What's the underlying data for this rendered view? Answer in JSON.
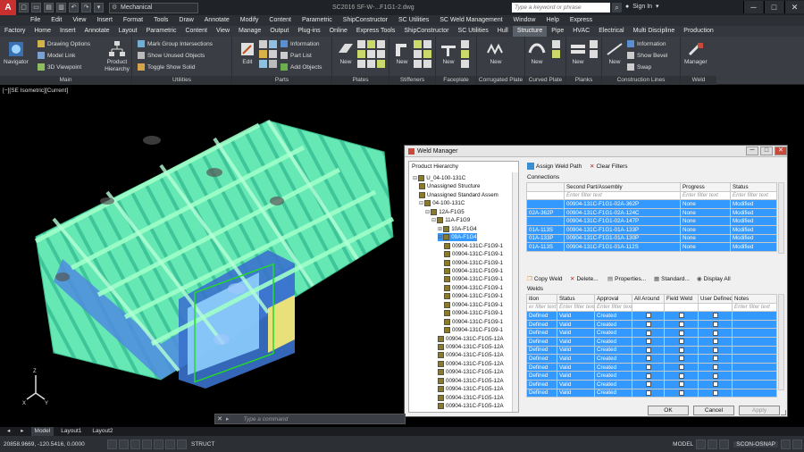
{
  "titlebar": {
    "app_letter": "A",
    "workspace": "Mechanical",
    "doc_title": "SC2016    SF-W-...F1G1-2.dwg",
    "search_placeholder": "Type a keyword or phrase",
    "signin": "Sign In",
    "qat": [
      "▢",
      "▭",
      "▤",
      "▥",
      "↶",
      "↷",
      "▾"
    ]
  },
  "menus": [
    "File",
    "Edit",
    "View",
    "Insert",
    "Format",
    "Tools",
    "Draw",
    "Annotate",
    "Modify",
    "Content",
    "Parametric",
    "ShipConstructor",
    "SC Utilities",
    "SC Weld Management",
    "Window",
    "Help",
    "Express"
  ],
  "ribbon_tabs": [
    "Factory",
    "Home",
    "Insert",
    "Annotate",
    "Layout",
    "Parametric",
    "Content",
    "View",
    "Manage",
    "Output",
    "Plug-ins",
    "Online",
    "Express Tools",
    "ShipConstructor",
    "SC Utilities",
    "Hull",
    "Structure",
    "Pipe",
    "HVAC",
    "Electrical",
    "Multi Discipline",
    "Production"
  ],
  "active_tab": "Structure",
  "ribbon": {
    "main": {
      "title": "Main",
      "navigator": "Navigator",
      "drawing_options": "Drawing Options",
      "model_link": "Model Link",
      "viewpoint": "3D Viewpoint",
      "product_hierarchy": "Product Hierarchy"
    },
    "utilities": {
      "title": "Utilities",
      "mark_group": "Mark Group Intersections",
      "show_unused": "Show Unused Objects",
      "toggle_solid": "Toggle Show Solid"
    },
    "parts": {
      "title": "Parts",
      "edit": "Edit",
      "information": "Information",
      "part_list": "Part List",
      "add_objects": "Add Objects"
    },
    "plates": {
      "title": "Plates",
      "new": "New"
    },
    "stiffeners": {
      "title": "Stiffeners",
      "new": "New"
    },
    "faceplate": {
      "title": "Faceplate",
      "new": "New"
    },
    "corrugated": {
      "title": "Corrugated Plate",
      "new": "New"
    },
    "curved": {
      "title": "Curved Plate",
      "new": "New"
    },
    "planks": {
      "title": "Planks",
      "new": "New"
    },
    "construction": {
      "title": "Construction Lines",
      "new": "New",
      "information": "Information",
      "show_bevel": "Show Bevel",
      "swap": "Swap"
    },
    "weld": {
      "title": "Weld",
      "manager": "Manager"
    }
  },
  "viewport": {
    "label": "[−][SE Isometric][Current]"
  },
  "command": {
    "placeholder": "Type a command",
    "close": "✕"
  },
  "layouts": [
    "Model",
    "Layout1",
    "Layout2"
  ],
  "active_layout": "Model",
  "status": {
    "coords": "20858.9669, -120.5416, 0.0000",
    "ortho": "STRUCT",
    "model": "MODEL",
    "scon": "SCON-OSNAP"
  },
  "weld_manager": {
    "title": "Weld Manager",
    "ph_title": "Product Hierarchy",
    "tree": [
      {
        "label": "U_04-100-131C",
        "depth": 0,
        "exp": "⊟"
      },
      {
        "label": "Unassigned Structure",
        "depth": 1,
        "exp": ""
      },
      {
        "label": "Unassigned Standard Assem",
        "depth": 1,
        "exp": ""
      },
      {
        "label": "04-100-131C",
        "depth": 1,
        "exp": "⊟"
      },
      {
        "label": "12A-F1G5",
        "depth": 2,
        "exp": "⊟"
      },
      {
        "label": "11A-F1G9",
        "depth": 3,
        "exp": "⊟"
      },
      {
        "label": "10A-F1G4",
        "depth": 4,
        "exp": "⊞"
      },
      {
        "label": "09A-F1G4",
        "depth": 4,
        "exp": "⊟",
        "sel": true
      },
      {
        "label": "00904-131C-F1G9-1",
        "depth": 5,
        "exp": ""
      },
      {
        "label": "00904-131C-F1G9-1",
        "depth": 5,
        "exp": ""
      },
      {
        "label": "00904-131C-F1G9-1",
        "depth": 5,
        "exp": ""
      },
      {
        "label": "00904-131C-F1G9-1",
        "depth": 5,
        "exp": ""
      },
      {
        "label": "00904-131C-F1G9-1",
        "depth": 5,
        "exp": ""
      },
      {
        "label": "00904-131C-F1G9-1",
        "depth": 5,
        "exp": ""
      },
      {
        "label": "00904-131C-F1G9-1",
        "depth": 5,
        "exp": ""
      },
      {
        "label": "00904-131C-F1G9-1",
        "depth": 5,
        "exp": ""
      },
      {
        "label": "00904-131C-F1G9-1",
        "depth": 5,
        "exp": ""
      },
      {
        "label": "00904-131C-F1G9-1",
        "depth": 5,
        "exp": ""
      },
      {
        "label": "00904-131C-F1G9-1",
        "depth": 5,
        "exp": ""
      },
      {
        "label": "00904-131C-F1G5-12A",
        "depth": 4,
        "exp": ""
      },
      {
        "label": "00904-131C-F1G5-12A",
        "depth": 4,
        "exp": ""
      },
      {
        "label": "00904-131C-F1G5-12A",
        "depth": 4,
        "exp": ""
      },
      {
        "label": "00904-131C-F1G5-12A",
        "depth": 4,
        "exp": ""
      },
      {
        "label": "00904-131C-F1G5-12A",
        "depth": 4,
        "exp": ""
      },
      {
        "label": "00904-131C-F1G5-12A",
        "depth": 4,
        "exp": ""
      },
      {
        "label": "00904-131C-F1G5-12A",
        "depth": 4,
        "exp": ""
      },
      {
        "label": "00904-131C-F1G5-12A",
        "depth": 4,
        "exp": ""
      },
      {
        "label": "00904-131C-F1G5-12A",
        "depth": 4,
        "exp": ""
      }
    ],
    "assign_weld_path": "Assign Weld Path",
    "clear_filters": "Clear Filters",
    "connections_label": "Connections",
    "conn_headers": [
      "",
      "Second Part/Assembly",
      "Progress",
      "Status"
    ],
    "conn_filter": [
      "",
      "Enter filter text",
      "Enter filter text",
      "Enter filter text"
    ],
    "conn_rows": [
      [
        "",
        "00904-131C-F1G1-02A-362P",
        "None",
        "Modified"
      ],
      [
        "02A-362P",
        "00904-131C-F1G1-02A-124C",
        "None",
        "Modified"
      ],
      [
        "",
        "00904-131C-F1G1-02A-147P",
        "None",
        "Modified"
      ],
      [
        "01A-113S",
        "00904-131C-F1G1-01A-133P",
        "None",
        "Modified"
      ],
      [
        "01A-133P",
        "00904-131C-F1G1-01A-130P",
        "None",
        "Modified"
      ],
      [
        "01A-113S",
        "00904-131C-F1G1-01A-112S",
        "None",
        "Modified"
      ]
    ],
    "weld_toolbar": {
      "copy": "Copy Weld",
      "delete": "Delete...",
      "properties": "Properties...",
      "standard": "Standard...",
      "display_all": "Display All"
    },
    "welds_label": "Welds",
    "weld_headers": [
      "ition",
      "Status",
      "Approval",
      "All Around",
      "Field Weld",
      "User Defined",
      "Notes"
    ],
    "weld_filter": [
      "er filter text",
      "Enter filter text",
      "Enter filter text",
      "",
      "",
      "",
      "Enter filter text"
    ],
    "weld_rows": [
      [
        "Defined",
        "Valid",
        "Created"
      ],
      [
        "Defined",
        "Valid",
        "Created"
      ],
      [
        "Defined",
        "Valid",
        "Created"
      ],
      [
        "Defined",
        "Valid",
        "Created"
      ],
      [
        "Defined",
        "Valid",
        "Created"
      ],
      [
        "Defined",
        "Valid",
        "Created"
      ],
      [
        "Defined",
        "Valid",
        "Created"
      ],
      [
        "Defined",
        "Valid",
        "Created"
      ],
      [
        "Defined",
        "Valid",
        "Created"
      ],
      [
        "Defined",
        "Valid",
        "Created"
      ]
    ],
    "buttons": {
      "ok": "OK",
      "cancel": "Cancel",
      "apply": "Apply"
    }
  }
}
